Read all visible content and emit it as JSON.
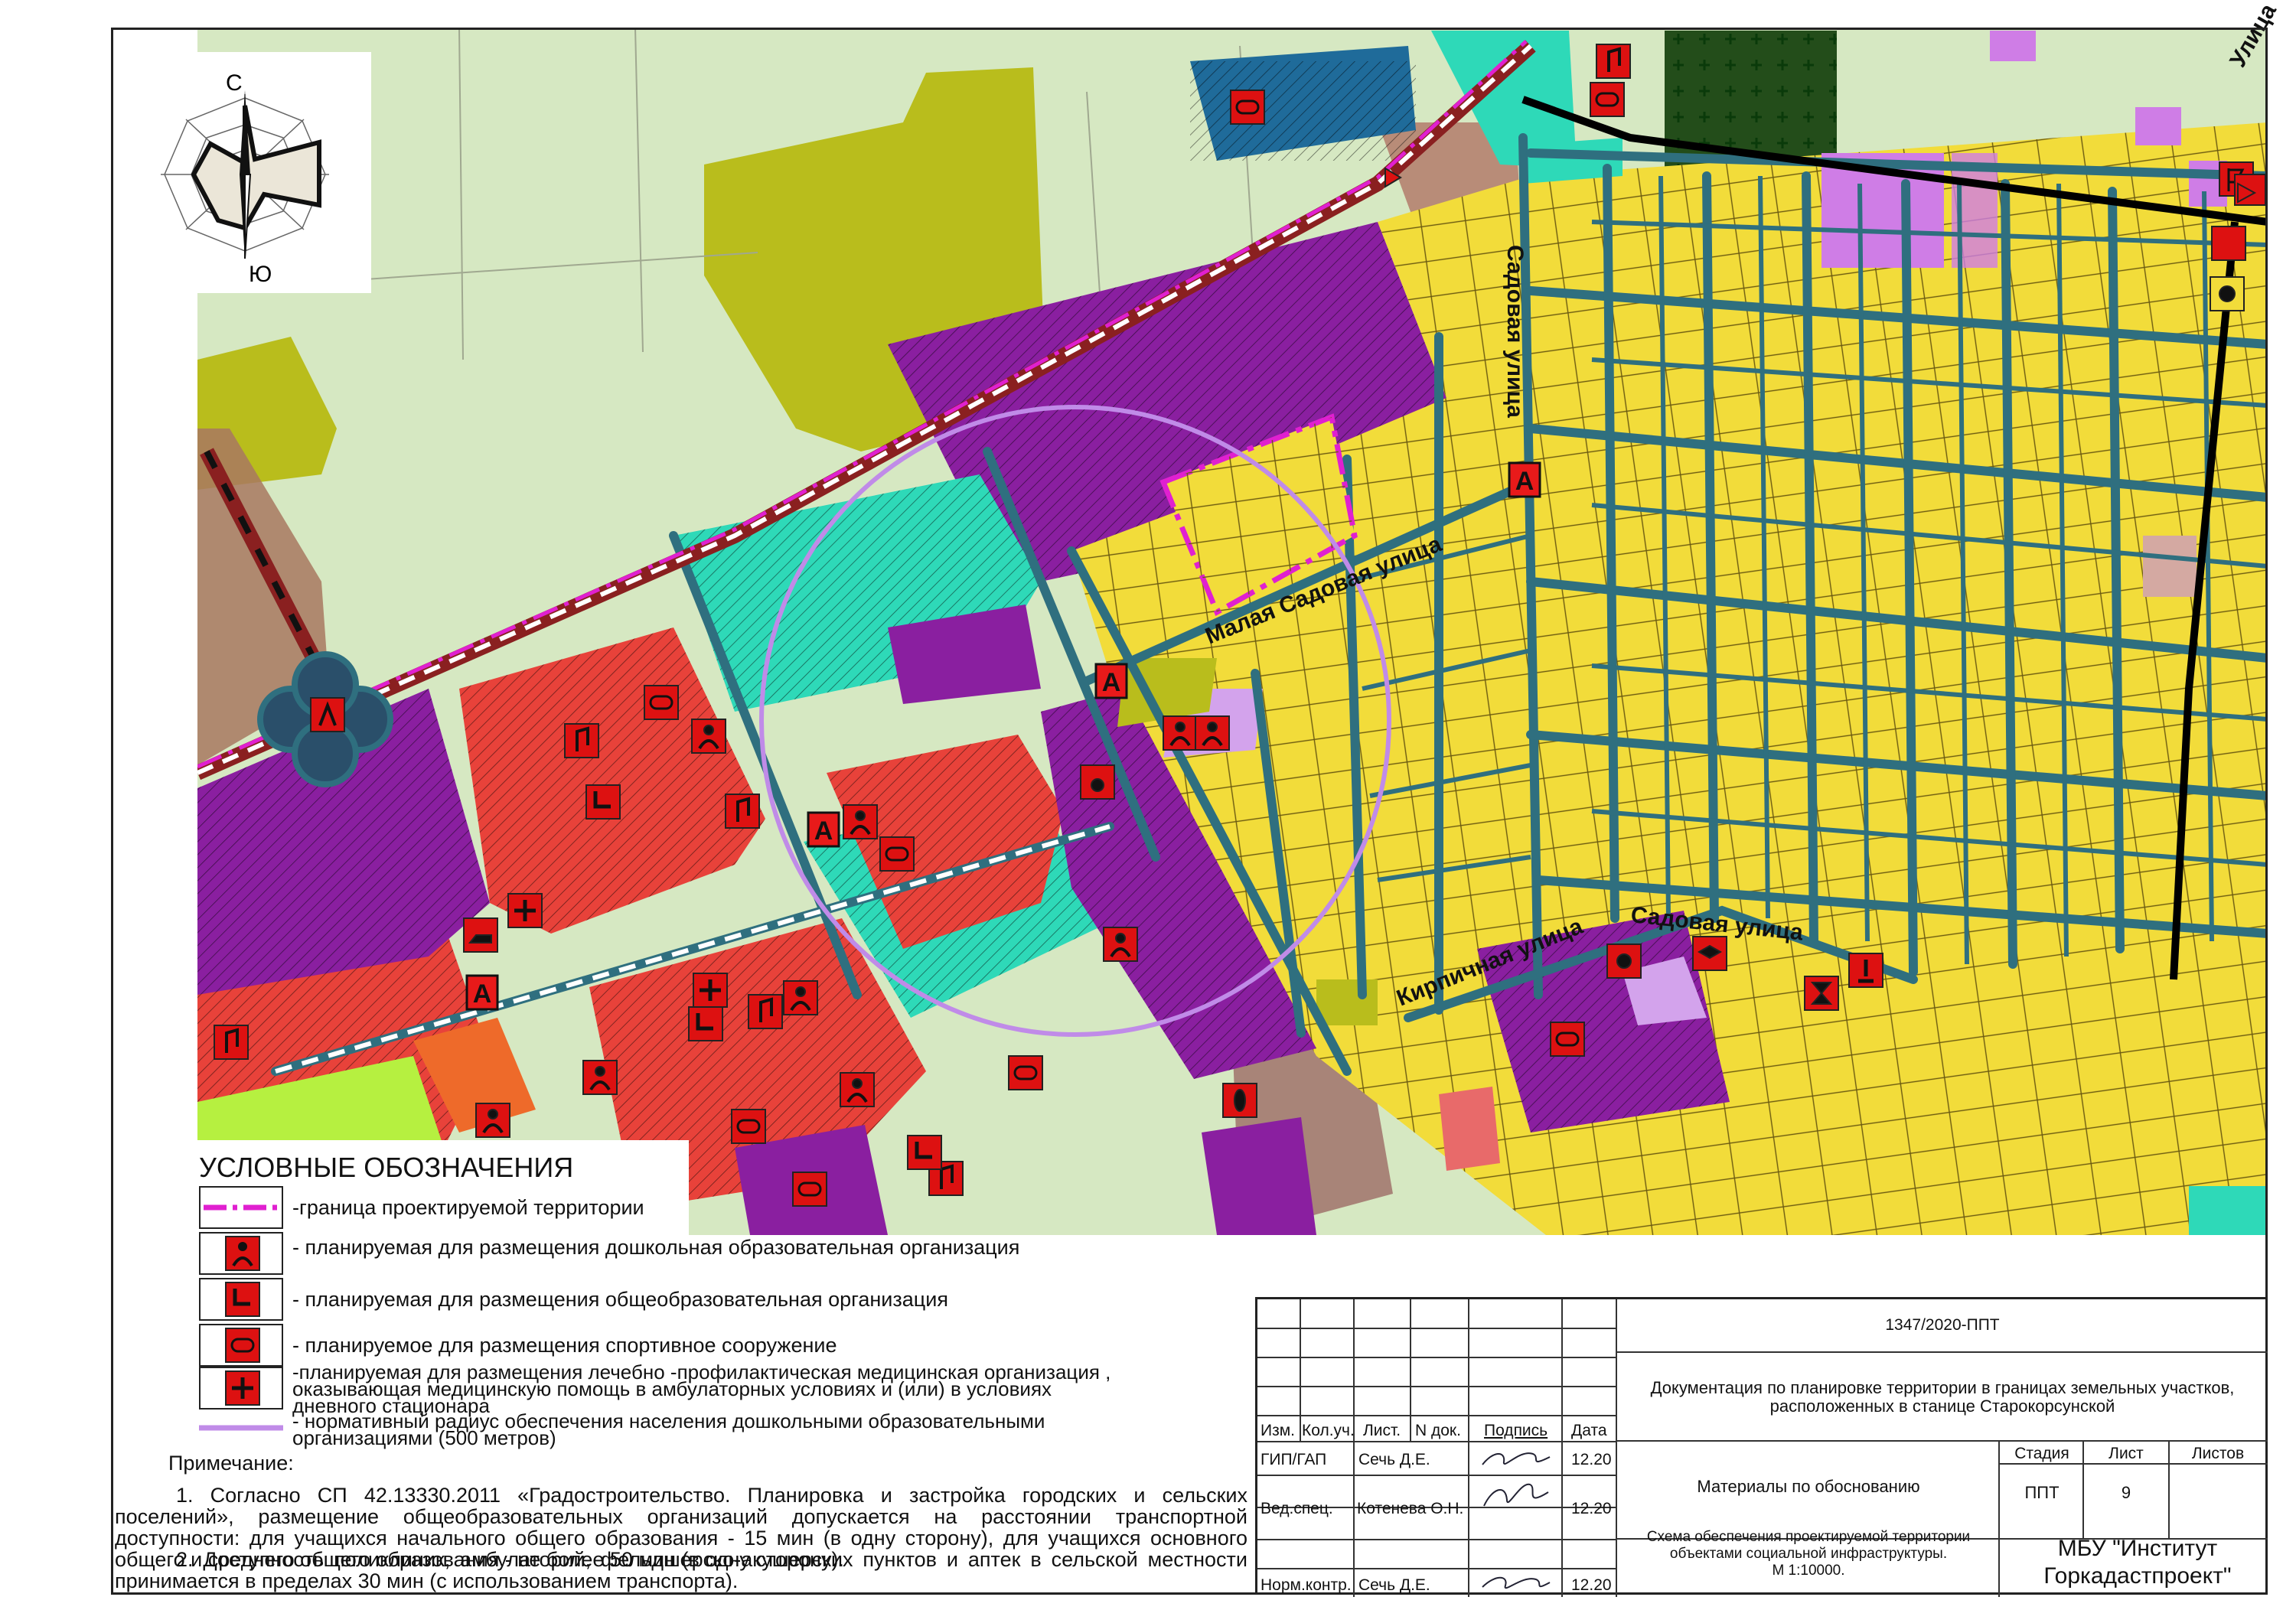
{
  "compass": {
    "north": "С",
    "south": "Ю"
  },
  "map_labels": {
    "street_sadovaya_vertical": "Садовая улица",
    "street_malaya_sadovaya": "Малая Садовая улица",
    "street_kirpichnaya": "Кирпичная улица",
    "street_sadovaya": "Садовая улица",
    "street_top_right": "Улица",
    "route_marker": "А"
  },
  "legend": {
    "title": "УСЛОВНЫЕ ОБОЗНАЧЕНИЯ",
    "items": [
      {
        "symbol": "boundary-line",
        "text": "-граница проектируемой территории"
      },
      {
        "symbol": "kindergarten-icon",
        "text": "- планируемая для размещения дошкольная образовательная организация"
      },
      {
        "symbol": "school-icon",
        "text": "- планируемая для размещения общеобразовательная организация"
      },
      {
        "symbol": "sports-icon",
        "text": "- планируемое для размещения спортивное сооружение"
      },
      {
        "symbol": "medical-cross-icon",
        "text": "-планируемая для размещения лечебно -профилактическая медицинская организация ,\nоказывающая медицинскую помощь в амбулаторных условиях и   (или) в условиях\nдневного стационара"
      },
      {
        "symbol": "radius-line",
        "text": "- нормативный радиус  обеспечения населения дошкольными образовательными\nорганизациями  (500 метров)"
      }
    ]
  },
  "notes": {
    "heading": "Примечание:",
    "items": [
      "1. Согласно СП 42.13330.2011 «Градостроительство. Планировка и застройка городских и сельских поселений», размещение общеобразовательных организаций допускается на расстоянии транспортной доступности: для учащихся начального общего образования - 15 мин (в одну сторону), для учащихся основного общего и среднего общего образования  - не более 50 мин (в одну сторону).",
      "2. Доступность поликлиник, амбулаторий, фельдшерско-акушерских пунктов и аптек в сельской местности принимается в пределах  30 мин (с использованием транспорта)."
    ]
  },
  "stamp": {
    "code": "1347/2020-ППТ",
    "doc_title": "Документация по планировке территории в границах земельных участков, расположенных в станице Старокорсунской",
    "section": "Материалы по обоснованию",
    "sheet_title": "Схема обеспечения проектируемой территории объектами социальной инфраструктуры.\nМ 1:10000.",
    "org": "МБУ \"Институт Горкадастпроект\"",
    "cols": [
      "Изм.",
      "Кол.уч.",
      "Лист.",
      "N док.",
      "Подпись",
      "Дата"
    ],
    "stage_headers": [
      "Стадия",
      "Лист",
      "Листов"
    ],
    "stage_values": [
      "ППТ",
      "9",
      ""
    ],
    "signers": [
      {
        "role": "ГИП/ГАП",
        "name": "Сечь Д.Е.",
        "date": "12.20"
      },
      {
        "role": "Вед.спец.",
        "name": "Котенева О.Н.",
        "date": "12.20"
      },
      {
        "role": "Норм.контр.",
        "name": "Сечь Д.Е.",
        "date": "12.20"
      }
    ]
  },
  "colors": {
    "residential_yellow": "#f2dc3a",
    "public_purple": "#8a1fa0",
    "commercial_red": "#e8423a",
    "green_cyan": "#2ed9b8",
    "agri_light": "#d6e8c2",
    "olive": "#b9bd1c",
    "street_blue": "#2f6f7f",
    "boundary_magenta": "#e020d0",
    "radius_lilac": "#c08be8",
    "marker_red": "#dd1111"
  }
}
